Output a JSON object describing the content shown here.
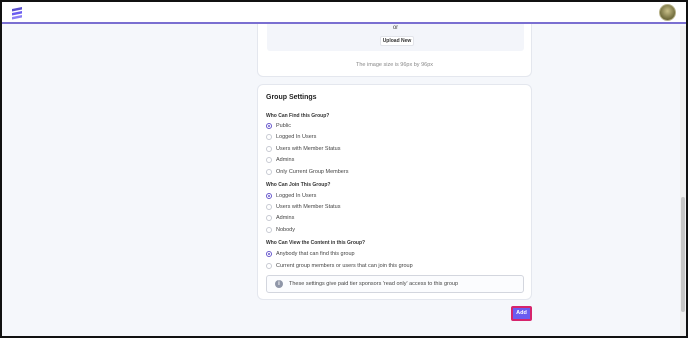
{
  "upload": {
    "or_text": "or",
    "upload_button": "Upload New",
    "size_note": "The image size is 96px by 96px"
  },
  "group_settings": {
    "title": "Group Settings",
    "find": {
      "label": "Who Can Find this Group?",
      "options": [
        "Public",
        "Logged In Users",
        "Users with Member Status",
        "Admins",
        "Only Current Group Members"
      ],
      "selected": "Public"
    },
    "join": {
      "label": "Who Can Join This Group?",
      "options": [
        "Logged In Users",
        "Users with Member Status",
        "Admins",
        "Nobody"
      ],
      "selected": "Logged In Users"
    },
    "view": {
      "label": "Who Can View the Content in this Group?",
      "options": [
        "Anybody that can find this group",
        "Current group members or users that can join this group"
      ],
      "selected": "Anybody that can find this group"
    },
    "info_text": "These settings give paid tier sponsors 'read only' access to this group"
  },
  "actions": {
    "add_label": "Add"
  },
  "colors": {
    "accent": "#6a5cf0",
    "highlight_border": "#d6246c"
  }
}
